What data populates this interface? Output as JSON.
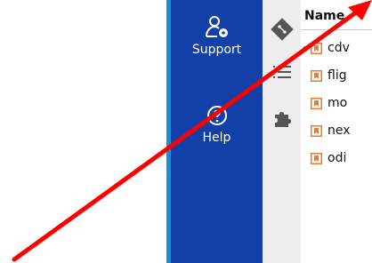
{
  "sidebar": {
    "support_label": "Support",
    "help_label": "Help",
    "support_icon": "user-gear-icon",
    "help_icon": "help-circle-icon"
  },
  "activity_bar": {
    "icons": [
      "git-icon",
      "list-icon",
      "puzzle-extensions-icon"
    ]
  },
  "file_panel": {
    "header": "Name",
    "rows": [
      {
        "name": "cdv",
        "status_dot": true
      },
      {
        "name": "flig",
        "status_dot": false
      },
      {
        "name": "mo",
        "status_dot": false
      },
      {
        "name": "nex",
        "status_dot": false
      },
      {
        "name": "odi",
        "status_dot": false
      }
    ]
  },
  "colors": {
    "sidebar_bg": "#1340a8",
    "sidebar_edge": "#1a8fd8",
    "activity_bg": "#eeeeee",
    "file_icon": "#f07a2a",
    "status_dot": "#2aa63a",
    "annotation_arrow": "#ff0000"
  },
  "overlay": {
    "annotation": "red-arrow-pointing-up-right"
  }
}
